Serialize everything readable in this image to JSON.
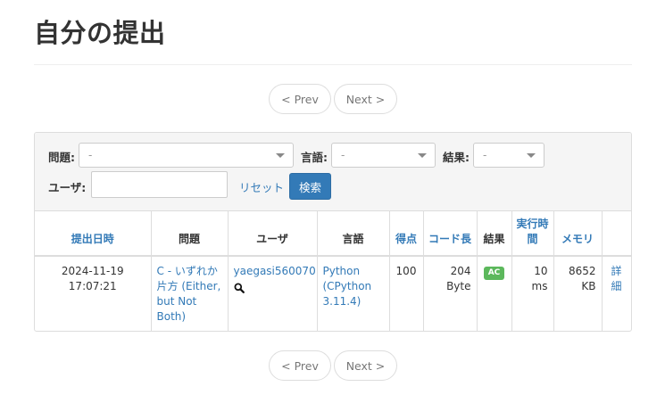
{
  "page": {
    "title": "自分の提出"
  },
  "pagination": {
    "prev": "< Prev",
    "next": "Next >"
  },
  "filters": {
    "problem_label": "問題:",
    "problem_value": "-",
    "language_label": "言語:",
    "language_value": "-",
    "result_label": "結果:",
    "result_value": "-",
    "user_label": "ユーザ:",
    "user_value": "",
    "reset_label": "リセット",
    "search_label": "検索"
  },
  "table": {
    "headers": {
      "date": "提出日時",
      "problem": "問題",
      "user": "ユーザ",
      "language": "言語",
      "score": "得点",
      "code_length": "コード長",
      "result": "結果",
      "exec_time": "実行時間",
      "memory": "メモリ"
    },
    "rows": [
      {
        "date": "2024-11-19 17:07:21",
        "problem": "C - いずれか片方 (Either, but Not Both)",
        "user": "yaegasi560070",
        "language": "Python (CPython 3.11.4)",
        "score": "100",
        "code_length": "204 Byte",
        "result": "AC",
        "exec_time": "10 ms",
        "memory": "8652 KB",
        "detail": "詳細"
      }
    ]
  },
  "colors": {
    "link": "#337ab7",
    "primary_button": "#337ab7",
    "ac_badge": "#5cb85c"
  }
}
